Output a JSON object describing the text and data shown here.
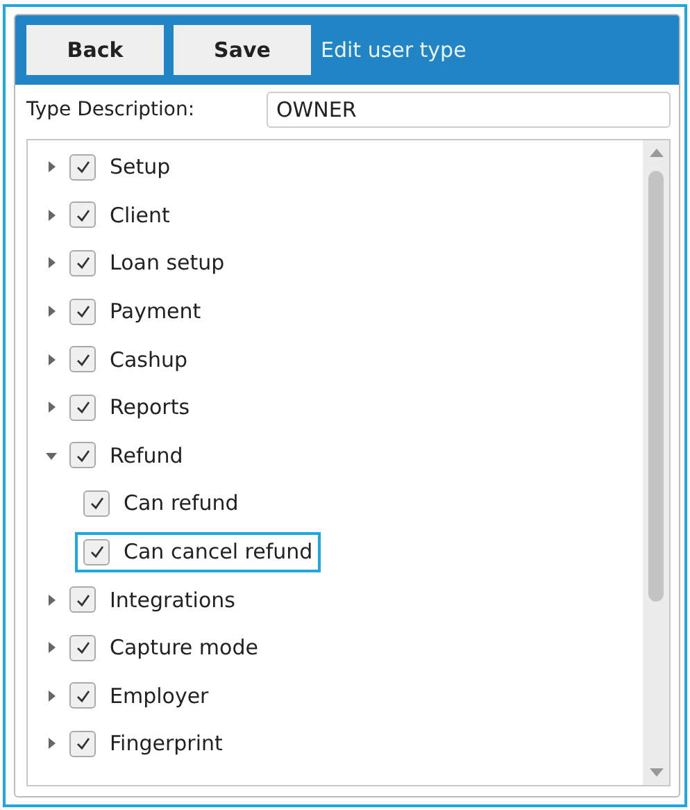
{
  "header": {
    "buttons": [
      "Back",
      "Save"
    ],
    "title": "Edit user type"
  },
  "type_description": {
    "label": "Type Description:",
    "value": "OWNER"
  },
  "tree": [
    {
      "label": "Setup",
      "checked": true,
      "expanded": false,
      "selected": false
    },
    {
      "label": "Client",
      "checked": true,
      "expanded": false,
      "selected": false
    },
    {
      "label": "Loan setup",
      "checked": true,
      "expanded": false,
      "selected": false
    },
    {
      "label": "Payment",
      "checked": true,
      "expanded": false,
      "selected": false
    },
    {
      "label": "Cashup",
      "checked": true,
      "expanded": false,
      "selected": false
    },
    {
      "label": "Reports",
      "checked": true,
      "expanded": false,
      "selected": false
    },
    {
      "label": "Refund",
      "checked": true,
      "expanded": true,
      "selected": false,
      "children": [
        {
          "label": "Can refund",
          "checked": true,
          "selected": false
        },
        {
          "label": "Can cancel refund",
          "checked": true,
          "selected": true
        }
      ]
    },
    {
      "label": "Integrations",
      "checked": true,
      "expanded": false,
      "selected": false
    },
    {
      "label": "Capture mode",
      "checked": true,
      "expanded": false,
      "selected": false
    },
    {
      "label": "Employer",
      "checked": true,
      "expanded": false,
      "selected": false
    },
    {
      "label": "Fingerprint",
      "checked": true,
      "expanded": false,
      "selected": false
    }
  ]
}
